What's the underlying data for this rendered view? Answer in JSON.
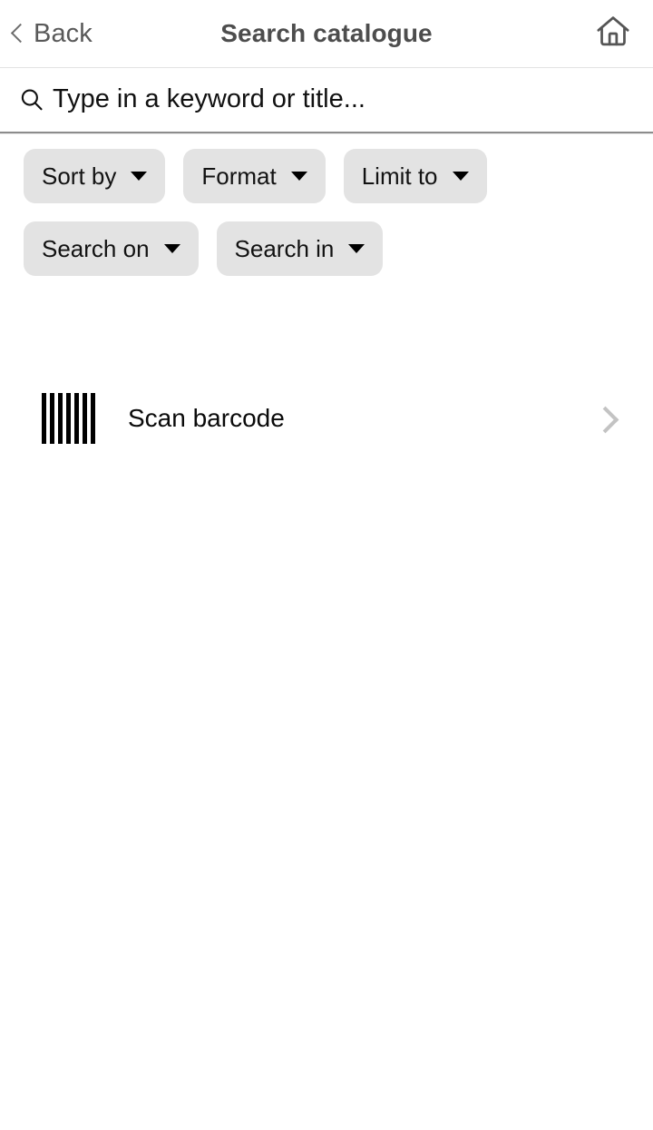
{
  "header": {
    "back_label": "Back",
    "back_icon": "chevron-left-icon",
    "title": "Search catalogue",
    "home_icon": "home-icon"
  },
  "search": {
    "icon": "search-icon",
    "value": "",
    "placeholder": "Type in a keyword or title..."
  },
  "filters": {
    "chips": [
      {
        "label": "Sort by",
        "icon": "chevron-down-icon"
      },
      {
        "label": "Format",
        "icon": "chevron-down-icon"
      },
      {
        "label": "Limit to",
        "icon": "chevron-down-icon"
      },
      {
        "label": "Search on",
        "icon": "chevron-down-icon"
      },
      {
        "label": "Search in",
        "icon": "chevron-down-icon"
      }
    ]
  },
  "scan": {
    "label": "Scan barcode",
    "icon": "barcode-icon",
    "chevron": "chevron-right-icon",
    "bars": 7
  },
  "colors": {
    "background": "#ffffff",
    "chip_background": "#e3e3e3",
    "title_text": "#4d4d4d",
    "back_text": "#595959",
    "body_text": "#0a0a0a",
    "divider": "#e2e2e2",
    "search_underline": "#8c8c8c",
    "chevron_right": "#c3c3c3"
  }
}
